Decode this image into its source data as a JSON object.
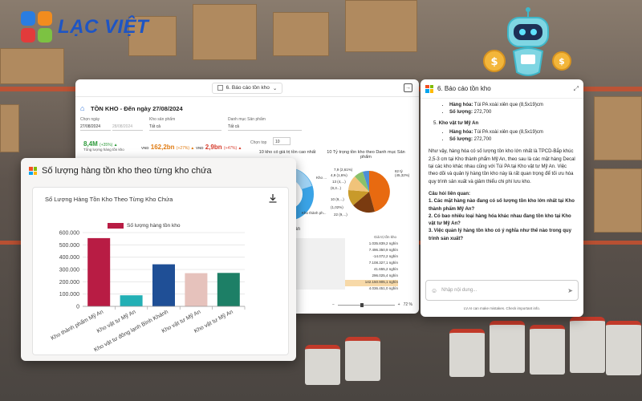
{
  "brand": {
    "name": "LẠC VIỆT"
  },
  "dashboard": {
    "report_select": "6. Báo cáo tồn kho",
    "title": "TỒN KHO - Đến ngày 27/08/2024",
    "filters": {
      "date_label": "Chọn ngày",
      "date_from": "27/08/2024",
      "date_to": "28/08/2024",
      "warehouse_label": "Kho sản phẩm",
      "warehouse_value": "Tất cả",
      "category_label": "Danh mục Sản phẩm",
      "category_value": "Tất cả",
      "top_label": "Chọn top",
      "top_value": "10"
    },
    "kpis": [
      {
        "value": "8,4M",
        "change": "(+35%) ▲",
        "caption": "Tổng lượng hàng tồn kho"
      },
      {
        "prefix": "VND",
        "value": "162,2bn",
        "change": "(+27%) ▲"
      },
      {
        "prefix": "VND",
        "value": "2,9bn",
        "change": "(+47%) ▲"
      }
    ],
    "chart_titles": {
      "top_value": "10 kho có giá trị tồn cao nhất",
      "ratio": "10 Tỷ trọng tồn kho theo Danh mục Sản phẩm"
    },
    "pie_labels": [
      "7,9 (2,61%)",
      "4,9 (1,6%)",
      "13 (4,...)",
      "(8,3...)",
      "10 (9,...)",
      "(1,02%)",
      "22 (9,...)",
      "22 (8 (15,77%)",
      "82 tỷ (45,32%)",
      "Kho ...",
      "Kho thành ph..."
    ],
    "table": {
      "section_label": "oàn",
      "header": "Giá trị tồn kho",
      "rows": [
        "1.035.839,2 nghìn",
        "7.496.350,9 nghìn",
        "-14.072,2 nghìn",
        "7.108.327,1 nghìn",
        "41.655,2 nghìn",
        "296.025,4 nghìn",
        "142.150.905,1 nghìn",
        "4.036.451,0 nghìn"
      ]
    },
    "zoom": "72 %"
  },
  "chat": {
    "title": "6. Báo cáo tồn kho",
    "items_before": [
      {
        "label": "Hàng hóa:",
        "value": "Túi PA xoài xiên que (8,5x19)cm"
      },
      {
        "label": "Số lượng:",
        "value": "272,700"
      }
    ],
    "section5": {
      "number": "5.",
      "title": "Kho vật tư Mỹ An"
    },
    "items_after": [
      {
        "label": "Hàng hóa:",
        "value": "Túi PA xoài xiên que (8,5x19)cm"
      },
      {
        "label": "Số lượng:",
        "value": "272,700"
      }
    ],
    "paragraph": "Như vậy, hàng hóa có số lượng tồn kho lớn nhất là TPCD-Bắp khúc 2,5-3 cm tại Kho thành phẩm Mỹ An, theo sau là các mặt hàng Decal tại các kho khác nhau cũng với Túi PA tại Kho vật tư Mỹ An. Việc theo dõi và quản lý hàng tồn kho này là rất quan trọng để tối ưu hóa quy trình sản xuất và giảm thiểu chi phí lưu kho.",
    "related_heading": "Câu hỏi liên quan:",
    "questions": [
      "1. Các mặt hàng nào đang có số lượng tồn kho lớn nhất tại Kho thành phẩm Mỹ An?",
      "2. Có bao nhiêu loại hàng hóa khác nhau đang tồn kho tại Kho vật tư Mỹ An?",
      "3. Việc quản lý hàng tồn kho có ý nghĩa như thế nào trong quy trình sản xuất?"
    ],
    "input_placeholder": "Nhập nội dung...",
    "footer": "LV.AI can make mistakes. Check important info."
  },
  "card": {
    "title": "Số lượng hàng tồn kho theo từng kho chứa",
    "inner_title": "Số Lượng Hàng Tồn Kho Theo Từng Kho Chứa"
  },
  "chart_data": {
    "type": "bar",
    "title": "Số Lượng Hàng Tồn Kho Theo Từng Kho Chứa",
    "categories": [
      "Kho thành phẩm Mỹ An",
      "Kho vật tư Mỹ An",
      "Kho vật tư đông lạnh Bình Khánh",
      "Kho vật tư Mỹ An",
      "Kho vật tư Mỹ An"
    ],
    "series": [
      {
        "name": "Số lượng hàng tồn kho",
        "values": [
          555000,
          90000,
          342000,
          270000,
          272000
        ],
        "colors": [
          "#b81c44",
          "#23b0b5",
          "#1f4f96",
          "#e6c2bc",
          "#1d7f66"
        ]
      }
    ],
    "yticks": [
      "600.000",
      "500.000",
      "400.000",
      "300.000",
      "200.000",
      "100.000",
      "0"
    ],
    "ylim": [
      0,
      600000
    ],
    "legend": "top",
    "grid": true
  }
}
